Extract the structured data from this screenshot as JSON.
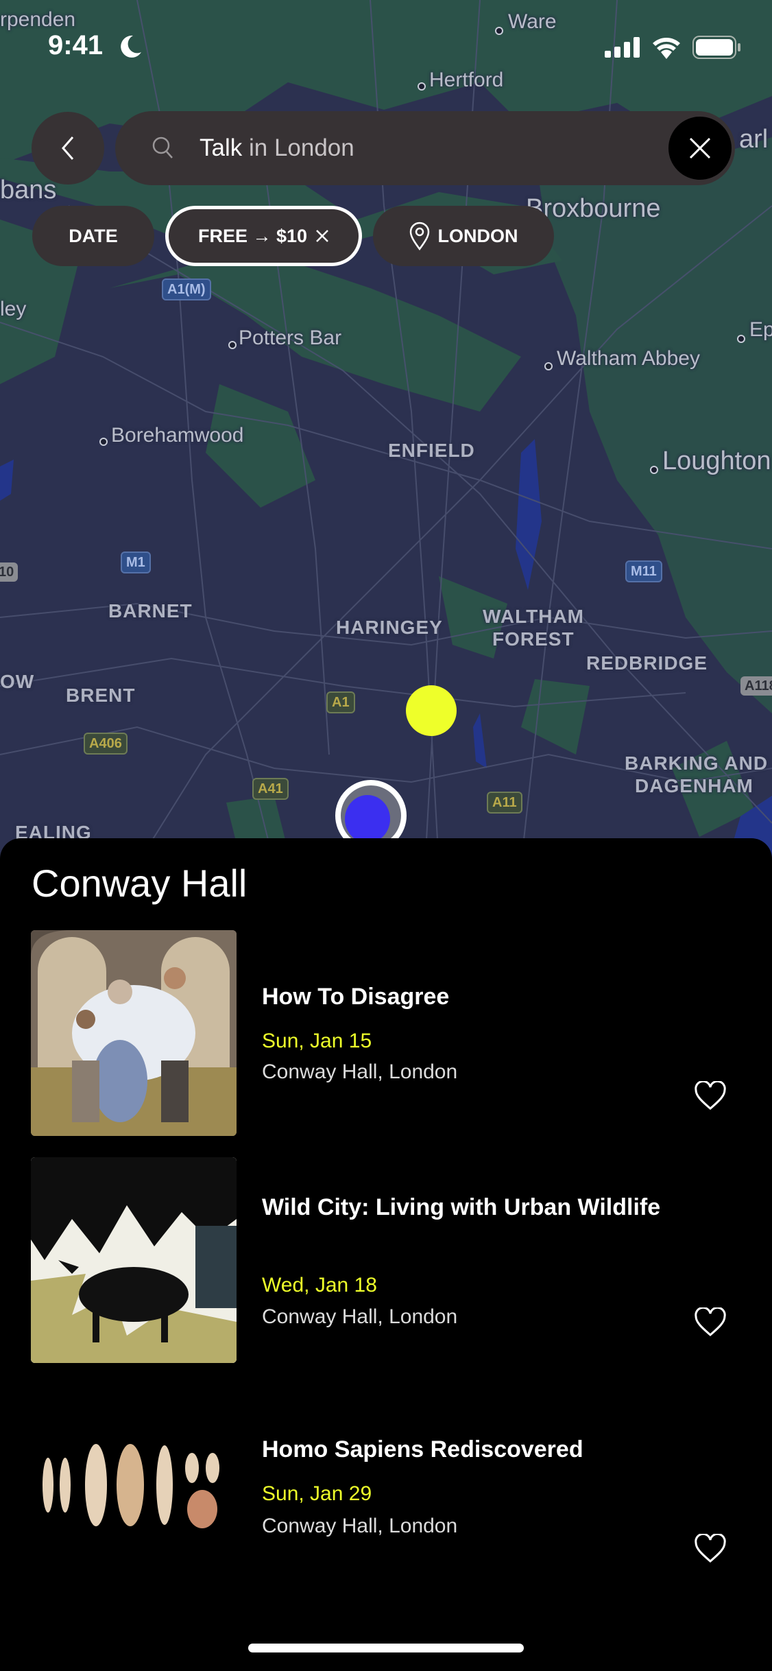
{
  "status_bar": {
    "time": "9:41"
  },
  "map": {
    "labels": [
      "rpenden",
      "Ware",
      "Hertford",
      "bans",
      "Broxbourne",
      "arl",
      "ley",
      "Potters Bar",
      "Waltham Abbey",
      "Ep",
      "Borehamwood",
      "ENFIELD",
      "Loughton",
      "BARNET",
      "HARINGEY",
      "WALTHAM",
      "FOREST",
      "REDBRIDGE",
      "OW",
      "BRENT",
      "BARKING AND",
      "DAGENHAM",
      "EALING"
    ],
    "road_badges": [
      "A1(M)",
      "M1",
      "10",
      "M11",
      "A118",
      "A1",
      "A406",
      "A41",
      "A11"
    ],
    "colors": {
      "land": "#2c3150",
      "parks": "#2b5249",
      "water": "#23358a",
      "event_marker": "#eeff2a",
      "selected_marker": "#3b2ff0"
    }
  },
  "search": {
    "query_bold": "Talk",
    "query_rest": " in London"
  },
  "filters": [
    {
      "label": "DATE"
    },
    {
      "label": "FREE → $10",
      "active": true
    },
    {
      "label": "LONDON"
    }
  ],
  "sheet": {
    "title": "Conway Hall",
    "events": [
      {
        "title": "How To Disagree",
        "date": "Sun, Jan 15",
        "location": "Conway Hall, London"
      },
      {
        "title": "Wild City: Living with Urban Wildlife",
        "date": "Wed, Jan 18",
        "location": "Conway Hall, London"
      },
      {
        "title": "Homo Sapiens Rediscovered",
        "date": "Sun, Jan 29",
        "location": "Conway Hall, London"
      }
    ]
  },
  "accent_color": "#eeff2a"
}
